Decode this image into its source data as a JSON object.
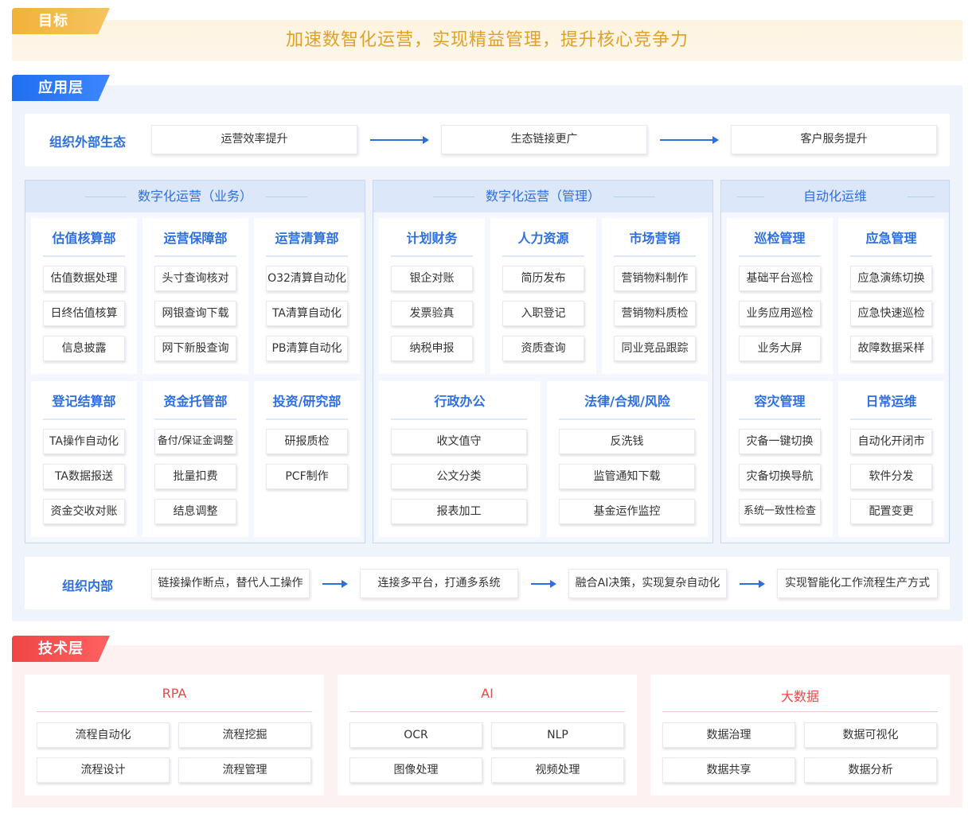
{
  "goal": {
    "tag": "目标",
    "text": "加速数智化运营，实现精益管理，提升核心竞争力"
  },
  "application": {
    "tag": "应用层",
    "external": {
      "label": "组织外部生态",
      "steps": [
        "运营效率提升",
        "生态链接更广",
        "客户服务提升"
      ]
    },
    "groups": [
      {
        "title": "数字化运营（业务）",
        "cards": [
          {
            "title": "估值核算部",
            "items": [
              "估值数据处理",
              "日终估值核算",
              "信息披露"
            ]
          },
          {
            "title": "运营保障部",
            "items": [
              "头寸查询核对",
              "网银查询下载",
              "网下新股查询"
            ]
          },
          {
            "title": "运营清算部",
            "items": [
              "O32清算自动化",
              "TA清算自动化",
              "PB清算自动化"
            ]
          },
          {
            "title": "登记结算部",
            "items": [
              "TA操作自动化",
              "TA数据报送",
              "资金交收对账"
            ]
          },
          {
            "title": "资金托管部",
            "items": [
              "备付/保证金调整",
              "批量扣费",
              "结息调整"
            ]
          },
          {
            "title": "投资/研究部",
            "items": [
              "研报质检",
              "PCF制作"
            ]
          }
        ]
      },
      {
        "title": "数字化运营（管理）",
        "cards": [
          {
            "title": "计划财务",
            "items": [
              "银企对账",
              "发票验真",
              "纳税申报"
            ]
          },
          {
            "title": "人力资源",
            "items": [
              "简历发布",
              "入职登记",
              "资质查询"
            ]
          },
          {
            "title": "市场营销",
            "items": [
              "营销物料制作",
              "营销物料质检",
              "同业竞品跟踪"
            ]
          },
          {
            "title": "行政办公",
            "items": [
              "收文值守",
              "公文分类",
              "报表加工"
            ]
          },
          {
            "title": "法律/合规/风险",
            "items": [
              "反洗钱",
              "监管通知下载",
              "基金运作监控"
            ]
          }
        ]
      },
      {
        "title": "自动化运维",
        "cards": [
          {
            "title": "巡检管理",
            "items": [
              "基础平台巡检",
              "业务应用巡检",
              "业务大屏"
            ]
          },
          {
            "title": "应急管理",
            "items": [
              "应急演练切换",
              "应急快速巡检",
              "故障数据采样"
            ]
          },
          {
            "title": "容灾管理",
            "items": [
              "灾备一键切换",
              "灾备切换导航",
              "系统一致性检查"
            ]
          },
          {
            "title": "日常运维",
            "items": [
              "自动化开闭市",
              "软件分发",
              "配置变更"
            ]
          }
        ]
      }
    ],
    "internal": {
      "label": "组织内部",
      "steps": [
        "链接操作断点，替代人工操作",
        "连接多平台，打通多系统",
        "融合AI决策，实现复杂自动化",
        "实现智能化工作流程生产方式"
      ]
    }
  },
  "tech": {
    "tag": "技术层",
    "cards": [
      {
        "title": "RPA",
        "items": [
          "流程自动化",
          "流程挖掘",
          "流程设计",
          "流程管理"
        ]
      },
      {
        "title": "AI",
        "items": [
          "OCR",
          "NLP",
          "图像处理",
          "视频处理"
        ]
      },
      {
        "title": "大数据",
        "items": [
          "数据治理",
          "数据可视化",
          "数据共享",
          "数据分析"
        ]
      }
    ]
  },
  "colors": {
    "goal": "#e0a12a",
    "app_accent": "#2d6fe0",
    "tech_accent": "#f04545"
  }
}
